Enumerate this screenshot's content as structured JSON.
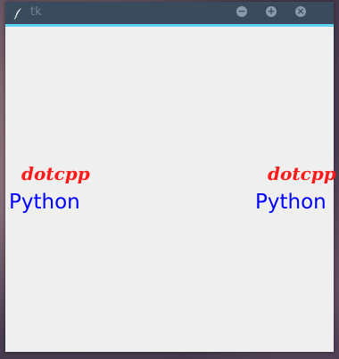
{
  "window": {
    "title": "tk",
    "buttons": {
      "minimize": "−",
      "maximize": "+",
      "close": "×"
    }
  },
  "labels": {
    "left_italic": "dotcpp",
    "left_plain": "Python",
    "right_italic": "dotcpp",
    "right_plain": "Python"
  },
  "colors": {
    "titlebar": "#3a4b5e",
    "titlebar_accent": "#5fd3f0",
    "window_bg": "#efefef",
    "italic_text": "#ff1a1a",
    "plain_text": "#0000ff"
  },
  "icons": {
    "app": "feather-icon",
    "minimize": "minimize-icon",
    "maximize": "maximize-icon",
    "close": "close-icon"
  }
}
